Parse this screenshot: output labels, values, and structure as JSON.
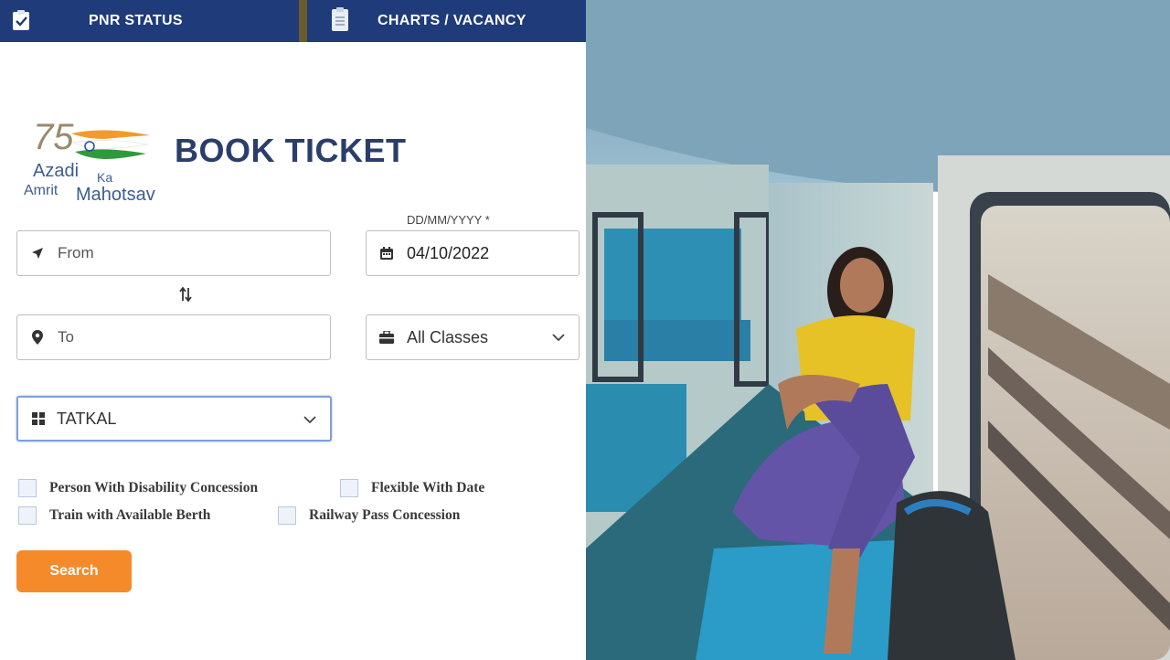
{
  "nav": {
    "pnr_label": "PNR STATUS",
    "charts_label": "CHARTS / VACANCY"
  },
  "logo": {
    "number": "75",
    "line1": "Azadi",
    "line1b": "Ka",
    "line2a": "Amrit",
    "line2b": "Mahotsav"
  },
  "form": {
    "title": "BOOK TICKET",
    "date_hint": "DD/MM/YYYY *",
    "from_placeholder": "From",
    "to_placeholder": "To",
    "date_value": "04/10/2022",
    "class_value": "All Classes",
    "quota_value": "TATKAL",
    "checkboxes": [
      "Person With Disability Concession",
      "Flexible With Date",
      "Train with Available Berth",
      "Railway Pass Concession"
    ],
    "search_label": "Search"
  },
  "colors": {
    "nav_bg": "#1f3b7a",
    "accent": "#f58a2a",
    "title": "#2b3e6b"
  }
}
